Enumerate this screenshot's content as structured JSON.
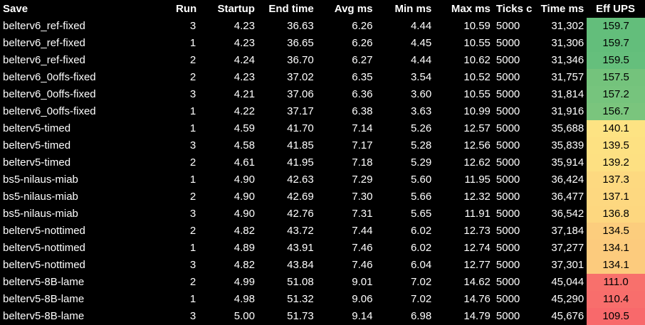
{
  "columns": {
    "save": "Save",
    "run": "Run",
    "startup": "Startup",
    "end_time": "End time",
    "avg_ms": "Avg ms",
    "min_ms": "Min ms",
    "max_ms": "Max ms",
    "ticks": "Ticks c",
    "time_ms": "Time ms",
    "eff_ups": "Eff UPS"
  },
  "colors": {
    "background": "#000000",
    "text": "#ffffff"
  },
  "rows": [
    {
      "save": "belterv6_ref-fixed",
      "run": "3",
      "startup": "4.23",
      "end_time": "36.63",
      "avg_ms": "6.26",
      "min_ms": "4.44",
      "max_ms": "10.59",
      "ticks": "5000",
      "time_ms": "31,302",
      "eff_ups": "159.7",
      "ups_color": "#63be7b"
    },
    {
      "save": "belterv6_ref-fixed",
      "run": "1",
      "startup": "4.23",
      "end_time": "36.65",
      "avg_ms": "6.26",
      "min_ms": "4.45",
      "max_ms": "10.55",
      "ticks": "5000",
      "time_ms": "31,306",
      "eff_ups": "159.7",
      "ups_color": "#63be7b"
    },
    {
      "save": "belterv6_ref-fixed",
      "run": "2",
      "startup": "4.24",
      "end_time": "36.70",
      "avg_ms": "6.27",
      "min_ms": "4.44",
      "max_ms": "10.62",
      "ticks": "5000",
      "time_ms": "31,346",
      "eff_ups": "159.5",
      "ups_color": "#65bf7c"
    },
    {
      "save": "belterv6_0offs-fixed",
      "run": "2",
      "startup": "4.23",
      "end_time": "37.02",
      "avg_ms": "6.35",
      "min_ms": "3.54",
      "max_ms": "10.52",
      "ticks": "5000",
      "time_ms": "31,757",
      "eff_ups": "157.5",
      "ups_color": "#74c37c"
    },
    {
      "save": "belterv6_0offs-fixed",
      "run": "3",
      "startup": "4.21",
      "end_time": "37.06",
      "avg_ms": "6.36",
      "min_ms": "3.60",
      "max_ms": "10.55",
      "ticks": "5000",
      "time_ms": "31,814",
      "eff_ups": "157.2",
      "ups_color": "#76c47d"
    },
    {
      "save": "belterv6_0offs-fixed",
      "run": "1",
      "startup": "4.22",
      "end_time": "37.17",
      "avg_ms": "6.38",
      "min_ms": "3.63",
      "max_ms": "10.99",
      "ticks": "5000",
      "time_ms": "31,916",
      "eff_ups": "156.7",
      "ups_color": "#7ac57d"
    },
    {
      "save": "belterv5-timed",
      "run": "1",
      "startup": "4.59",
      "end_time": "41.70",
      "avg_ms": "7.14",
      "min_ms": "5.26",
      "max_ms": "12.57",
      "ticks": "5000",
      "time_ms": "35,688",
      "eff_ups": "140.1",
      "ups_color": "#fde383"
    },
    {
      "save": "belterv5-timed",
      "run": "3",
      "startup": "4.58",
      "end_time": "41.85",
      "avg_ms": "7.17",
      "min_ms": "5.28",
      "max_ms": "12.56",
      "ticks": "5000",
      "time_ms": "35,839",
      "eff_ups": "139.5",
      "ups_color": "#fde182"
    },
    {
      "save": "belterv5-timed",
      "run": "2",
      "startup": "4.61",
      "end_time": "41.95",
      "avg_ms": "7.18",
      "min_ms": "5.29",
      "max_ms": "12.62",
      "ticks": "5000",
      "time_ms": "35,914",
      "eff_ups": "139.2",
      "ups_color": "#fde082"
    },
    {
      "save": "bs5-nilaus-miab",
      "run": "1",
      "startup": "4.90",
      "end_time": "42.63",
      "avg_ms": "7.29",
      "min_ms": "5.60",
      "max_ms": "11.95",
      "ticks": "5000",
      "time_ms": "36,424",
      "eff_ups": "137.3",
      "ups_color": "#fdd980"
    },
    {
      "save": "bs5-nilaus-miab",
      "run": "2",
      "startup": "4.90",
      "end_time": "42.69",
      "avg_ms": "7.30",
      "min_ms": "5.66",
      "max_ms": "12.32",
      "ticks": "5000",
      "time_ms": "36,477",
      "eff_ups": "137.1",
      "ups_color": "#fdd880"
    },
    {
      "save": "bs5-nilaus-miab",
      "run": "3",
      "startup": "4.90",
      "end_time": "42.76",
      "avg_ms": "7.31",
      "min_ms": "5.65",
      "max_ms": "11.91",
      "ticks": "5000",
      "time_ms": "36,542",
      "eff_ups": "136.8",
      "ups_color": "#fdd77f"
    },
    {
      "save": "belterv5-nottimed",
      "run": "2",
      "startup": "4.82",
      "end_time": "43.72",
      "avg_ms": "7.44",
      "min_ms": "6.02",
      "max_ms": "12.73",
      "ticks": "5000",
      "time_ms": "37,184",
      "eff_ups": "134.5",
      "ups_color": "#fccd7d"
    },
    {
      "save": "belterv5-nottimed",
      "run": "1",
      "startup": "4.89",
      "end_time": "43.91",
      "avg_ms": "7.46",
      "min_ms": "6.02",
      "max_ms": "12.74",
      "ticks": "5000",
      "time_ms": "37,277",
      "eff_ups": "134.1",
      "ups_color": "#fccb7d"
    },
    {
      "save": "belterv5-nottimed",
      "run": "3",
      "startup": "4.82",
      "end_time": "43.84",
      "avg_ms": "7.46",
      "min_ms": "6.04",
      "max_ms": "12.77",
      "ticks": "5000",
      "time_ms": "37,301",
      "eff_ups": "134.1",
      "ups_color": "#fccb7d"
    },
    {
      "save": "belterv5-8B-lame",
      "run": "2",
      "startup": "4.99",
      "end_time": "51.08",
      "avg_ms": "9.01",
      "min_ms": "7.02",
      "max_ms": "14.62",
      "ticks": "5000",
      "time_ms": "45,044",
      "eff_ups": "111.0",
      "ups_color": "#f8706c"
    },
    {
      "save": "belterv5-8B-lame",
      "run": "1",
      "startup": "4.98",
      "end_time": "51.32",
      "avg_ms": "9.06",
      "min_ms": "7.02",
      "max_ms": "14.76",
      "ticks": "5000",
      "time_ms": "45,290",
      "eff_ups": "110.4",
      "ups_color": "#f86e6c"
    },
    {
      "save": "belterv5-8B-lame",
      "run": "3",
      "startup": "5.00",
      "end_time": "51.73",
      "avg_ms": "9.14",
      "min_ms": "6.98",
      "max_ms": "14.79",
      "ticks": "5000",
      "time_ms": "45,676",
      "eff_ups": "109.5",
      "ups_color": "#f8696b"
    }
  ]
}
